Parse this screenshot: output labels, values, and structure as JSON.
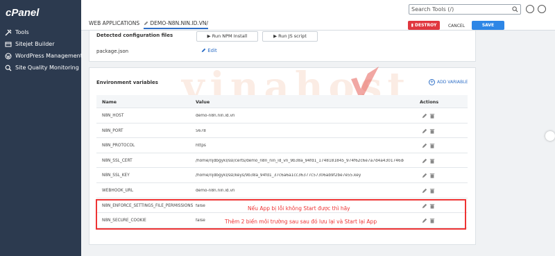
{
  "app": {
    "logo": "cPanel"
  },
  "sidebar": {
    "items": [
      {
        "label": "Tools",
        "icon": "tools-icon"
      },
      {
        "label": "Sitejet Builder",
        "icon": "sitejet-icon"
      },
      {
        "label": "WordPress Management",
        "icon": "wordpress-icon"
      },
      {
        "label": "Site Quality Monitoring",
        "icon": "monitoring-icon"
      }
    ]
  },
  "header": {
    "search_placeholder": "Search Tools (/)"
  },
  "tabs": [
    {
      "label": "WEB APPLICATIONS"
    },
    {
      "label": "DEMO-N8N.NIN.ID.VN/"
    }
  ],
  "actions": {
    "destroy_label": "DESTROY",
    "cancel_label": "CANCEL",
    "save_label": "SAVE"
  },
  "config": {
    "section_title": "Detected configuration files",
    "run_npm_label": "Run NPM Install",
    "run_js_label": "Run JS script",
    "file_name": "package.json",
    "edit_label": "Edit"
  },
  "env": {
    "section_title": "Environment variables",
    "add_label": "ADD VARIABLE",
    "columns": [
      "Name",
      "Value",
      "Actions"
    ],
    "rows": [
      {
        "name": "N8N_HOST",
        "value": "demo-n8n.nin.id.vn"
      },
      {
        "name": "N8N_PORT",
        "value": "5678"
      },
      {
        "name": "N8N_PROTOCOL",
        "value": "https"
      },
      {
        "name": "N8N_SSL_CERT",
        "value": "/home/njdbgykl/ssl/certs/demo_n8n_nin_id_vn_9b38a_94fd1_1748181845_974f62c6e7a7d4a4301746ddcff2f071.crt"
      },
      {
        "name": "N8N_SSL_KEY",
        "value": "/home/njdbgykl/ssl/keys/9b38a_94fd1_37c6a6a1cc36377c57306ab9f2be7e55.key"
      },
      {
        "name": "WEBHOOK_URL",
        "value": "demo-n8n.nin.id.vn"
      },
      {
        "name": "N8N_ENFORCE_SETTINGS_FILE_PERMISSIONS",
        "value": "false"
      },
      {
        "name": "N8N_SECURE_COOKIE",
        "value": "false"
      }
    ]
  },
  "annotation": {
    "line1": "Nếu App bị lỗi không Start được thì hãy",
    "line2": "Thêm 2 biến môi trường sau sau đó lưu lại và Start lại App"
  },
  "watermark": {
    "text": "vinahost"
  },
  "colors": {
    "sidebar": "#2c3a4f",
    "destroy": "#e0373f",
    "save": "#2d86e6",
    "link": "#2d6ec7",
    "annotation": "#ee3333"
  }
}
